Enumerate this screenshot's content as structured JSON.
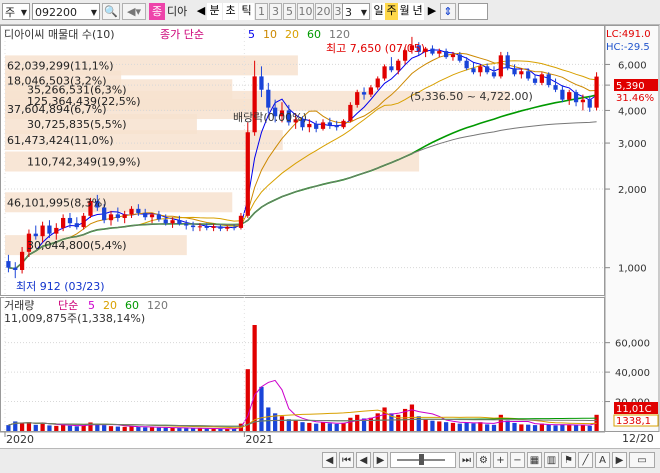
{
  "toolbar": {
    "market_label": "주",
    "code": "092200",
    "name_badge": "종",
    "name_text": "디아",
    "period_tabs": [
      "분",
      "초",
      "틱",
      "1",
      "3",
      "5",
      "10",
      "20",
      "30"
    ],
    "count": "3",
    "unit_tabs": [
      "일",
      "주",
      "월",
      "년"
    ],
    "selected_unit": "주"
  },
  "price_panel": {
    "title": "디아이씨 매물대 수(10)",
    "ma_label": "종가 단순",
    "ma_periods": [
      "5",
      "10",
      "20",
      "60",
      "120"
    ],
    "ma_colors": [
      "#0000ee",
      "#cc8800",
      "#d8a000",
      "#009900",
      "#777777"
    ],
    "high_note": "최고 7,650 (07/05)",
    "low_note": "최저 912 (03/23)",
    "dividend_note": "배당락(0.00%)",
    "range_note": "(5,336.50 ~ 4,722.00)",
    "lc_label": "LC:491.0",
    "hc_label": "HC:-29.5",
    "current_price": "5,390",
    "current_pct": "31.46%"
  },
  "volume_profile": [
    {
      "label": "18,046,503(3,2%)",
      "price": 5200,
      "fraction": 0.23
    },
    {
      "label": "35,266,531(6,3%)",
      "price": 4820,
      "fraction": 0.45
    },
    {
      "label": "62,039,299(11,1%)",
      "price": 5950,
      "fraction": 0.58
    },
    {
      "label": "125,364,439(22,5%)",
      "price": 4350,
      "fraction": 1.0
    },
    {
      "label": "37,604,894(6,7%)",
      "price": 4050,
      "fraction": 0.5
    },
    {
      "label": "30,725,835(5,5%)",
      "price": 3550,
      "fraction": 0.38
    },
    {
      "label": "61,473,424(11,0%)",
      "price": 3080,
      "fraction": 0.55
    },
    {
      "label": "110,742,349(19,9%)",
      "price": 2550,
      "fraction": 0.82
    },
    {
      "label": "46,101,995(8,3%)",
      "price": 1780,
      "fraction": 0.45
    },
    {
      "label": "30,044,800(5,4%)",
      "price": 1220,
      "fraction": 0.36
    }
  ],
  "volume_panel": {
    "title": "거래량",
    "ma_label": "단순",
    "ma_periods": [
      "5",
      "20",
      "60",
      "120"
    ],
    "ma_colors": [
      "#cc00cc",
      "#d8a000",
      "#009900",
      "#777777"
    ],
    "last_value": "11,009,875주(1,338,14%)",
    "last_badge": "11,01C",
    "ma_badge": "1338,1"
  },
  "x_axis": {
    "labels": [
      "2020",
      "2021"
    ],
    "right_label": "12/20"
  },
  "chart_data": {
    "type": "candlestick",
    "title": "디아이씨 매물대 수(10)",
    "y_scale": "log",
    "ylim": [
      800,
      8200
    ],
    "y_ticks": [
      1000,
      2000,
      3000,
      4000,
      5000,
      6000
    ],
    "volume_ylim": [
      0,
      72000
    ],
    "volume_ticks": [
      20000,
      40000,
      60000
    ],
    "x_tick_labels": [
      "2020",
      "2021"
    ],
    "candles": [
      {
        "o": 1060,
        "h": 1120,
        "l": 960,
        "c": 1000,
        "v": 4000
      },
      {
        "o": 1000,
        "h": 1050,
        "l": 912,
        "c": 980,
        "v": 6500
      },
      {
        "o": 980,
        "h": 1200,
        "l": 950,
        "c": 1150,
        "v": 5800
      },
      {
        "o": 1150,
        "h": 1400,
        "l": 1100,
        "c": 1350,
        "v": 6000
      },
      {
        "o": 1350,
        "h": 1450,
        "l": 1280,
        "c": 1320,
        "v": 4200
      },
      {
        "o": 1320,
        "h": 1500,
        "l": 1250,
        "c": 1450,
        "v": 5000
      },
      {
        "o": 1450,
        "h": 1520,
        "l": 1300,
        "c": 1350,
        "v": 3800
      },
      {
        "o": 1350,
        "h": 1480,
        "l": 1280,
        "c": 1420,
        "v": 3500
      },
      {
        "o": 1420,
        "h": 1600,
        "l": 1380,
        "c": 1550,
        "v": 4200
      },
      {
        "o": 1550,
        "h": 1620,
        "l": 1420,
        "c": 1480,
        "v": 3600
      },
      {
        "o": 1480,
        "h": 1560,
        "l": 1400,
        "c": 1430,
        "v": 3200
      },
      {
        "o": 1430,
        "h": 1620,
        "l": 1400,
        "c": 1580,
        "v": 3800
      },
      {
        "o": 1580,
        "h": 1850,
        "l": 1550,
        "c": 1800,
        "v": 5800
      },
      {
        "o": 1800,
        "h": 1900,
        "l": 1650,
        "c": 1700,
        "v": 4800
      },
      {
        "o": 1700,
        "h": 1750,
        "l": 1480,
        "c": 1520,
        "v": 4000
      },
      {
        "o": 1520,
        "h": 1650,
        "l": 1450,
        "c": 1600,
        "v": 3300
      },
      {
        "o": 1600,
        "h": 1700,
        "l": 1500,
        "c": 1550,
        "v": 3000
      },
      {
        "o": 1550,
        "h": 1650,
        "l": 1480,
        "c": 1600,
        "v": 2800
      },
      {
        "o": 1600,
        "h": 1720,
        "l": 1550,
        "c": 1680,
        "v": 3100
      },
      {
        "o": 1680,
        "h": 1750,
        "l": 1580,
        "c": 1620,
        "v": 2700
      },
      {
        "o": 1620,
        "h": 1680,
        "l": 1520,
        "c": 1560,
        "v": 2500
      },
      {
        "o": 1560,
        "h": 1620,
        "l": 1480,
        "c": 1600,
        "v": 2400
      },
      {
        "o": 1600,
        "h": 1650,
        "l": 1500,
        "c": 1530,
        "v": 2300
      },
      {
        "o": 1530,
        "h": 1600,
        "l": 1450,
        "c": 1480,
        "v": 2200
      },
      {
        "o": 1480,
        "h": 1560,
        "l": 1420,
        "c": 1520,
        "v": 2100
      },
      {
        "o": 1520,
        "h": 1580,
        "l": 1450,
        "c": 1470,
        "v": 2000
      },
      {
        "o": 1470,
        "h": 1520,
        "l": 1400,
        "c": 1450,
        "v": 1900
      },
      {
        "o": 1450,
        "h": 1500,
        "l": 1380,
        "c": 1430,
        "v": 1800
      },
      {
        "o": 1430,
        "h": 1480,
        "l": 1380,
        "c": 1440,
        "v": 1700
      },
      {
        "o": 1440,
        "h": 1480,
        "l": 1390,
        "c": 1420,
        "v": 1600
      },
      {
        "o": 1420,
        "h": 1470,
        "l": 1380,
        "c": 1440,
        "v": 1500
      },
      {
        "o": 1440,
        "h": 1460,
        "l": 1380,
        "c": 1410,
        "v": 1500
      },
      {
        "o": 1410,
        "h": 1450,
        "l": 1380,
        "c": 1430,
        "v": 1400
      },
      {
        "o": 1430,
        "h": 1460,
        "l": 1390,
        "c": 1420,
        "v": 1400
      },
      {
        "o": 1420,
        "h": 1620,
        "l": 1400,
        "c": 1580,
        "v": 5000
      },
      {
        "o": 1580,
        "h": 3600,
        "l": 1550,
        "c": 3300,
        "v": 42000
      },
      {
        "o": 3300,
        "h": 6200,
        "l": 3200,
        "c": 5400,
        "v": 72000
      },
      {
        "o": 5400,
        "h": 5900,
        "l": 4500,
        "c": 4800,
        "v": 30000
      },
      {
        "o": 4800,
        "h": 5100,
        "l": 3900,
        "c": 4100,
        "v": 16000
      },
      {
        "o": 4100,
        "h": 4400,
        "l": 3600,
        "c": 3800,
        "v": 12000
      },
      {
        "o": 3800,
        "h": 4300,
        "l": 3600,
        "c": 4000,
        "v": 10000
      },
      {
        "o": 4000,
        "h": 4200,
        "l": 3500,
        "c": 3600,
        "v": 8000
      },
      {
        "o": 3600,
        "h": 3900,
        "l": 3400,
        "c": 3700,
        "v": 7000
      },
      {
        "o": 3700,
        "h": 3800,
        "l": 3350,
        "c": 3450,
        "v": 6000
      },
      {
        "o": 3450,
        "h": 3700,
        "l": 3300,
        "c": 3550,
        "v": 5500
      },
      {
        "o": 3550,
        "h": 3650,
        "l": 3300,
        "c": 3400,
        "v": 5000
      },
      {
        "o": 3400,
        "h": 3700,
        "l": 3350,
        "c": 3600,
        "v": 6000
      },
      {
        "o": 3600,
        "h": 3750,
        "l": 3400,
        "c": 3500,
        "v": 5200
      },
      {
        "o": 3500,
        "h": 3650,
        "l": 3350,
        "c": 3450,
        "v": 4800
      },
      {
        "o": 3450,
        "h": 3700,
        "l": 3400,
        "c": 3650,
        "v": 5500
      },
      {
        "o": 3650,
        "h": 4300,
        "l": 3600,
        "c": 4200,
        "v": 9000
      },
      {
        "o": 4200,
        "h": 4800,
        "l": 4100,
        "c": 4700,
        "v": 11000
      },
      {
        "o": 4700,
        "h": 4900,
        "l": 4400,
        "c": 4600,
        "v": 8500
      },
      {
        "o": 4600,
        "h": 5000,
        "l": 4500,
        "c": 4900,
        "v": 9000
      },
      {
        "o": 4900,
        "h": 5400,
        "l": 4800,
        "c": 5300,
        "v": 12000
      },
      {
        "o": 5300,
        "h": 6000,
        "l": 5200,
        "c": 5900,
        "v": 16000
      },
      {
        "o": 5900,
        "h": 6400,
        "l": 5600,
        "c": 5700,
        "v": 12000
      },
      {
        "o": 5700,
        "h": 6300,
        "l": 5500,
        "c": 6200,
        "v": 11000
      },
      {
        "o": 6200,
        "h": 7000,
        "l": 6000,
        "c": 6800,
        "v": 15000
      },
      {
        "o": 6800,
        "h": 7650,
        "l": 6600,
        "c": 7100,
        "v": 18000
      },
      {
        "o": 7100,
        "h": 7300,
        "l": 6500,
        "c": 6700,
        "v": 10000
      },
      {
        "o": 6700,
        "h": 7000,
        "l": 6400,
        "c": 6900,
        "v": 8000
      },
      {
        "o": 6900,
        "h": 7100,
        "l": 6500,
        "c": 6600,
        "v": 7000
      },
      {
        "o": 6600,
        "h": 6900,
        "l": 6400,
        "c": 6750,
        "v": 6500
      },
      {
        "o": 6750,
        "h": 6900,
        "l": 6300,
        "c": 6400,
        "v": 6000
      },
      {
        "o": 6400,
        "h": 6700,
        "l": 6200,
        "c": 6550,
        "v": 5500
      },
      {
        "o": 6550,
        "h": 6700,
        "l": 6100,
        "c": 6200,
        "v": 5000
      },
      {
        "o": 6200,
        "h": 6400,
        "l": 5700,
        "c": 5800,
        "v": 5800
      },
      {
        "o": 5800,
        "h": 6100,
        "l": 5500,
        "c": 5600,
        "v": 5200
      },
      {
        "o": 5600,
        "h": 6000,
        "l": 5400,
        "c": 5900,
        "v": 6000
      },
      {
        "o": 5900,
        "h": 6050,
        "l": 5500,
        "c": 5600,
        "v": 4500
      },
      {
        "o": 5600,
        "h": 5900,
        "l": 5300,
        "c": 5400,
        "v": 4200
      },
      {
        "o": 5400,
        "h": 6700,
        "l": 5300,
        "c": 6500,
        "v": 11000
      },
      {
        "o": 6500,
        "h": 6700,
        "l": 5700,
        "c": 5800,
        "v": 7000
      },
      {
        "o": 5800,
        "h": 6000,
        "l": 5400,
        "c": 5500,
        "v": 5500
      },
      {
        "o": 5500,
        "h": 5800,
        "l": 5300,
        "c": 5650,
        "v": 4500
      },
      {
        "o": 5650,
        "h": 5800,
        "l": 5200,
        "c": 5300,
        "v": 4300
      },
      {
        "o": 5300,
        "h": 5500,
        "l": 5000,
        "c": 5100,
        "v": 4000
      },
      {
        "o": 5100,
        "h": 5600,
        "l": 5000,
        "c": 5500,
        "v": 5000
      },
      {
        "o": 5500,
        "h": 5600,
        "l": 4900,
        "c": 5000,
        "v": 4200
      },
      {
        "o": 5000,
        "h": 5300,
        "l": 4700,
        "c": 4800,
        "v": 3800
      },
      {
        "o": 4800,
        "h": 5000,
        "l": 4300,
        "c": 4400,
        "v": 4500
      },
      {
        "o": 4400,
        "h": 4800,
        "l": 4200,
        "c": 4700,
        "v": 4000
      },
      {
        "o": 4700,
        "h": 4800,
        "l": 4150,
        "c": 4300,
        "v": 3900
      },
      {
        "o": 4300,
        "h": 4600,
        "l": 4000,
        "c": 4400,
        "v": 4200
      },
      {
        "o": 4400,
        "h": 4550,
        "l": 3950,
        "c": 4100,
        "v": 3500
      },
      {
        "o": 4100,
        "h": 5600,
        "l": 4000,
        "c": 5390,
        "v": 11010
      }
    ]
  }
}
